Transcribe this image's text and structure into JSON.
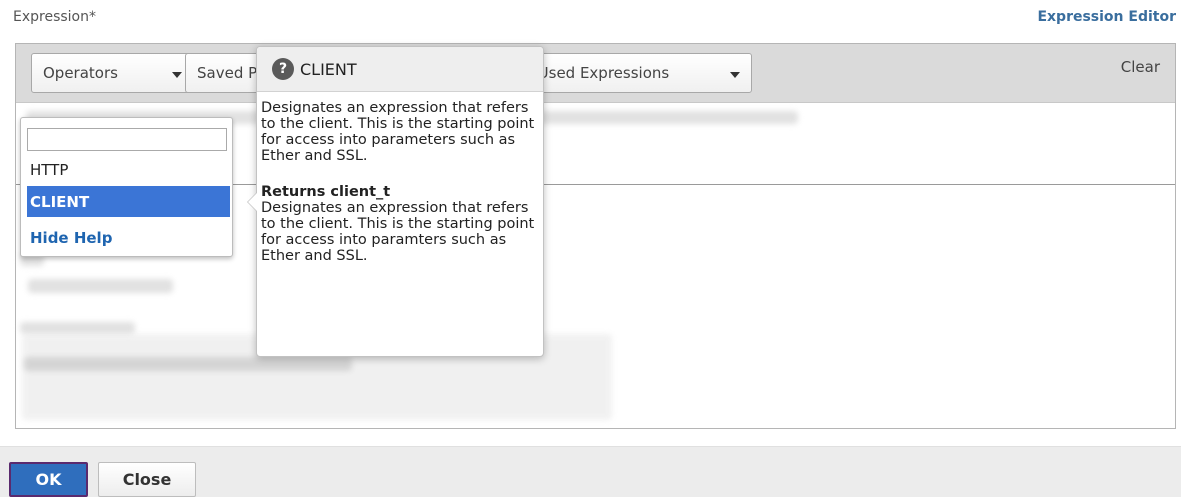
{
  "header": {
    "label": "Expression*",
    "editor_link": "Expression Editor"
  },
  "toolbar": {
    "operators_label": "Operators",
    "saved_label": "Saved P",
    "recent_label": "y Used Expressions",
    "clear_label": "Clear"
  },
  "dropdown": {
    "search_value": "",
    "items": [
      {
        "label": "HTTP"
      },
      {
        "label": "CLIENT"
      },
      {
        "label": "Hide Help"
      }
    ]
  },
  "popover": {
    "title": "CLIENT",
    "help_icon_glyph": "?",
    "description": "Designates an expression that refers to the client. This is the starting point for access into parameters such as Ether and SSL.",
    "returns_title": "Returns client_t",
    "returns_description": "Designates an expression that refers to the client. This is the starting point for access into paramters such as Ether and SSL."
  },
  "footer": {
    "ok_label": "OK",
    "close_label": "Close"
  },
  "colors": {
    "accent": "#2f6ebd",
    "selected": "#3b75d6",
    "link": "#3a6e9e",
    "toolbar_bg": "#dadada"
  }
}
